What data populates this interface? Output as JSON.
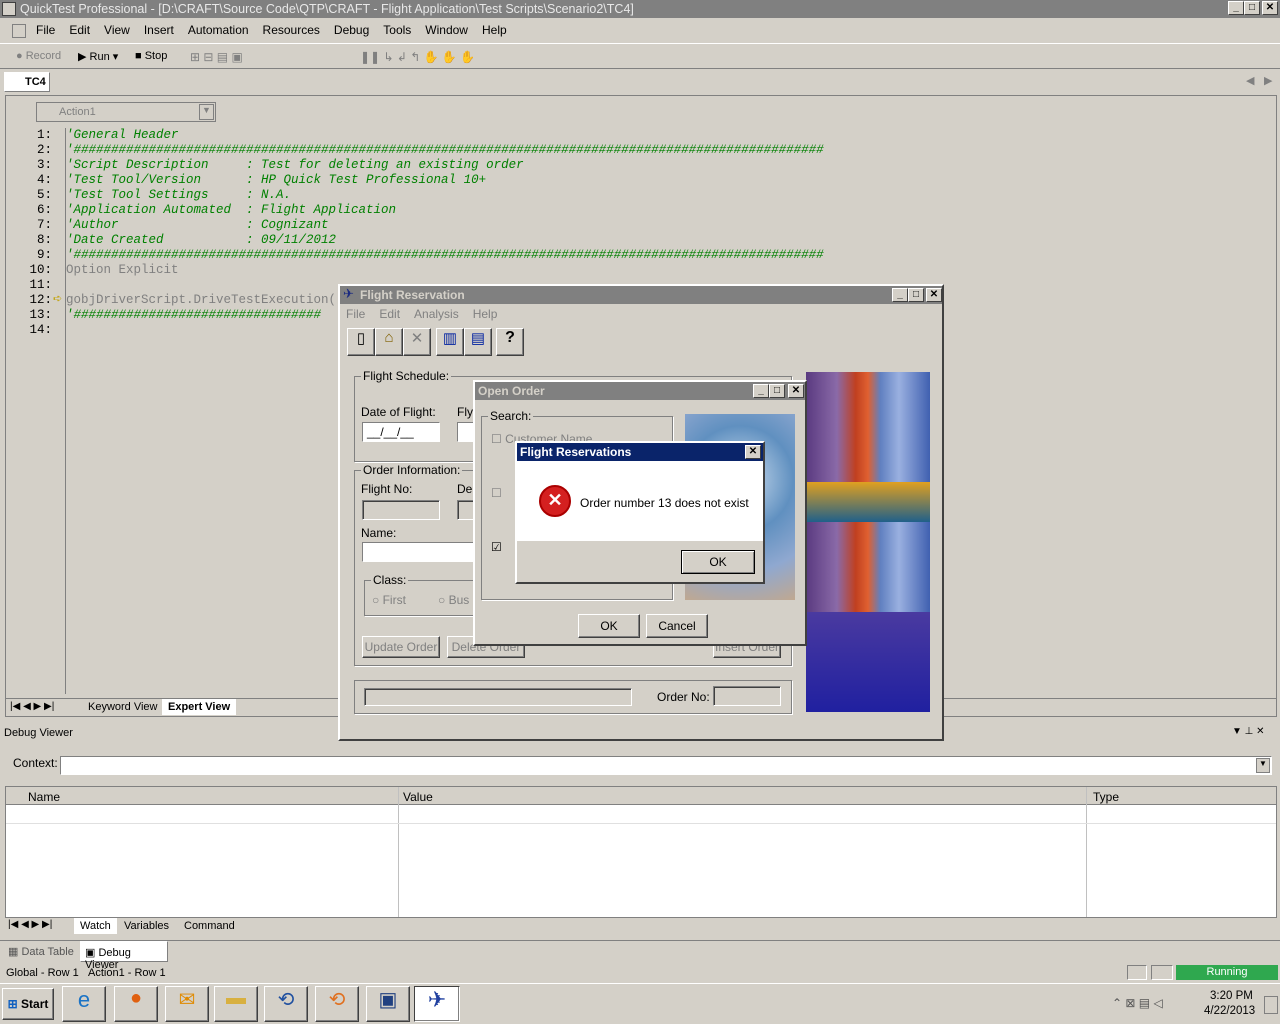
{
  "app": {
    "title": "QuickTest Professional - [D:\\CRAFT\\Source Code\\QTP\\CRAFT - Flight Application\\Test Scripts\\Scenario2\\TC4]",
    "menu": [
      "File",
      "Edit",
      "View",
      "Insert",
      "Automation",
      "Resources",
      "Debug",
      "Tools",
      "Window",
      "Help"
    ],
    "toolbar": {
      "record": "Record",
      "run": "Run",
      "stop": "Stop"
    },
    "doc_tab": "TC4",
    "action": "Action1",
    "code": [
      {
        "n": "1:",
        "t": "'General Header",
        "c": "cmt"
      },
      {
        "n": "2:",
        "t": "'####################################################################################################",
        "c": "cmt"
      },
      {
        "n": "3:",
        "t": "'Script Description     : Test for deleting an existing order",
        "c": "cmt"
      },
      {
        "n": "4:",
        "t": "'Test Tool/Version      : HP Quick Test Professional 10+",
        "c": "cmt"
      },
      {
        "n": "5:",
        "t": "'Test Tool Settings     : N.A.",
        "c": "cmt"
      },
      {
        "n": "6:",
        "t": "'Application Automated  : Flight Application",
        "c": "cmt"
      },
      {
        "n": "7:",
        "t": "'Author                 : Cognizant",
        "c": "cmt"
      },
      {
        "n": "8:",
        "t": "'Date Created           : 09/11/2012",
        "c": "cmt"
      },
      {
        "n": "9:",
        "t": "'####################################################################################################",
        "c": "cmt"
      },
      {
        "n": "10:",
        "t": "Option Explicit",
        "c": "kw"
      },
      {
        "n": "11:",
        "t": "",
        "c": "kw"
      },
      {
        "n": "12:",
        "t": "gobjDriverScript.DriveTestExecution()",
        "c": "kw"
      },
      {
        "n": "13:",
        "t": "'#################################",
        "c": "cmt"
      },
      {
        "n": "14:",
        "t": "",
        "c": "kw"
      }
    ],
    "view_tabs": [
      "Keyword View",
      "Expert View"
    ]
  },
  "debug": {
    "title": "Debug Viewer",
    "context_label": "Context:",
    "columns": [
      "Name",
      "Value",
      "Type"
    ],
    "tabs": [
      "Watch",
      "Variables",
      "Command"
    ]
  },
  "bottom_tabs": [
    "Data Table",
    "Debug Viewer"
  ],
  "status": {
    "left": "Global - Row 1",
    "mid": "Action1 - Row 1",
    "right": "Running"
  },
  "flight": {
    "title": "Flight Reservation",
    "menu": [
      "File",
      "Edit",
      "Analysis",
      "Help"
    ],
    "schedule": "Flight Schedule:",
    "date_label": "Date of Flight:",
    "date_value": "__/__/__",
    "fly": "Fly",
    "order_info": "Order Information:",
    "flight_no": "Flight No:",
    "dep": "Dep",
    "name": "Name:",
    "class": "Class:",
    "first": "First",
    "business": "Bus",
    "update": "Update Order",
    "delete": "Delete Order",
    "insert": "Insert Order",
    "order_no": "Order No:"
  },
  "open_order": {
    "title": "Open Order",
    "search": "Search:",
    "customer": "Customer Name",
    "ok": "OK",
    "cancel": "Cancel"
  },
  "msg": {
    "title": "Flight Reservations",
    "text": "Order number 13 does not exist",
    "ok": "OK"
  },
  "taskbar": {
    "start": "Start",
    "time": "3:20 PM",
    "date": "4/22/2013"
  }
}
